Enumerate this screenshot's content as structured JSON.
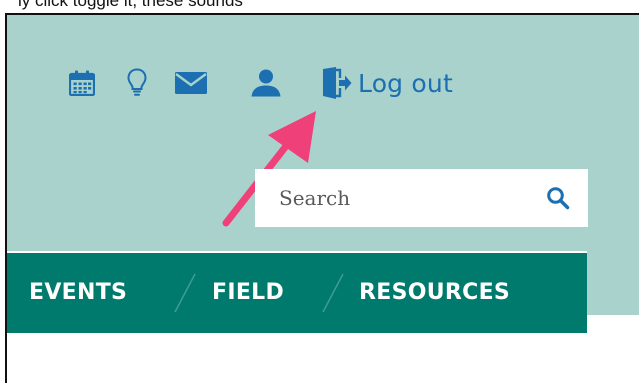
{
  "caption": {
    "text": "ly click toggle it, these sounds"
  },
  "header": {
    "background": "#a9d2cd",
    "icon_color": "#1c6fb0",
    "icons": [
      {
        "name": "calendar-icon"
      },
      {
        "name": "lightbulb-icon"
      },
      {
        "name": "mail-icon"
      },
      {
        "name": "user-icon"
      },
      {
        "name": "logout-icon"
      }
    ],
    "logout_label": "Log out"
  },
  "search": {
    "placeholder": "Search",
    "value": ""
  },
  "nav": {
    "background": "#007a6d",
    "items": [
      {
        "label": "EVENTS"
      },
      {
        "label": "FIELD"
      },
      {
        "label": "RESOURCES"
      }
    ]
  },
  "annotation": {
    "arrow_color": "#f0407a",
    "points_to": "user-icon"
  }
}
